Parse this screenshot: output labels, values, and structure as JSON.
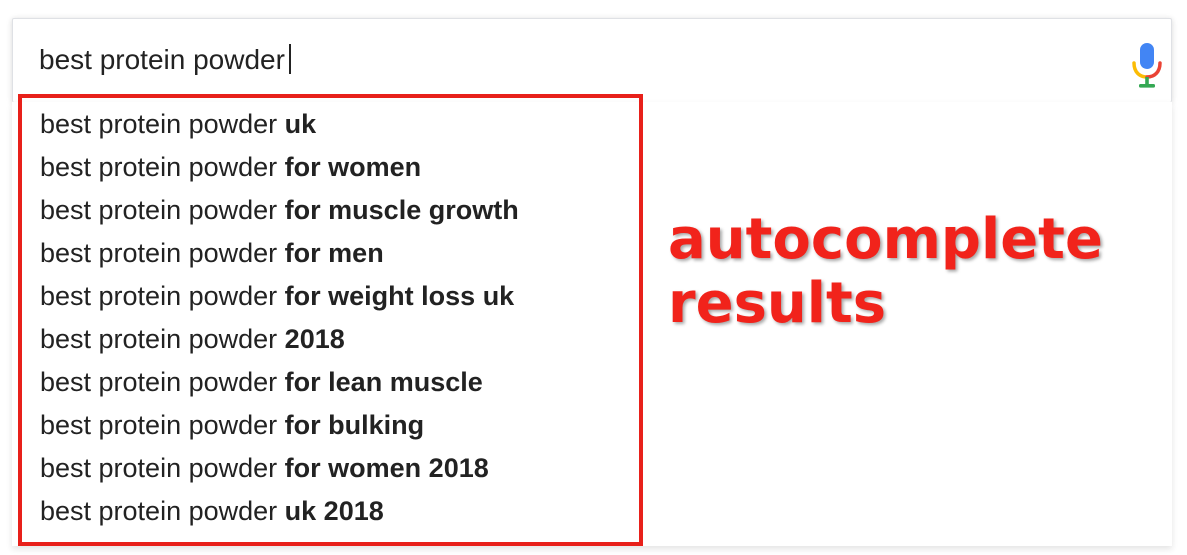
{
  "search": {
    "query": "best protein powder",
    "mic_icon": "microphone-icon"
  },
  "suggestions": [
    {
      "prefix": "best protein powder",
      "completion": "uk"
    },
    {
      "prefix": "best protein powder",
      "completion": "for women"
    },
    {
      "prefix": "best protein powder",
      "completion": "for muscle growth"
    },
    {
      "prefix": "best protein powder",
      "completion": "for men"
    },
    {
      "prefix": "best protein powder",
      "completion": "for weight loss uk"
    },
    {
      "prefix": "best protein powder",
      "completion": "2018"
    },
    {
      "prefix": "best protein powder",
      "completion": "for lean muscle"
    },
    {
      "prefix": "best protein powder",
      "completion": "for bulking"
    },
    {
      "prefix": "best protein powder",
      "completion": "for women 2018"
    },
    {
      "prefix": "best protein powder",
      "completion": "uk 2018"
    }
  ],
  "annotation": {
    "line1": "autocomplete",
    "line2": "results"
  },
  "colors": {
    "annotation": "#f1231b",
    "frame": "#e8201a",
    "text": "#222222",
    "mic_blue": "#4285f4",
    "mic_red": "#ea4335",
    "mic_yellow": "#fbbc05",
    "mic_green": "#34a853"
  }
}
